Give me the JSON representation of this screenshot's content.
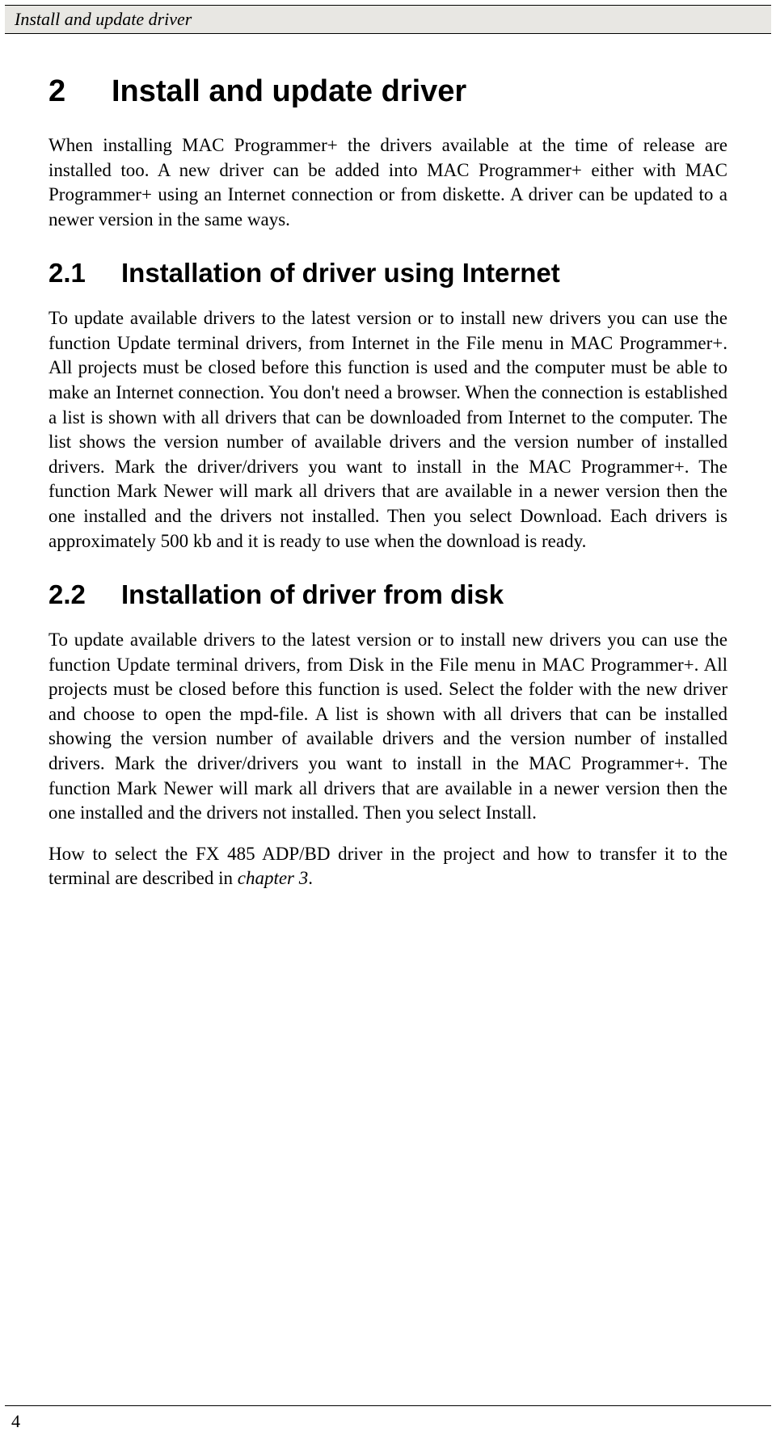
{
  "header": {
    "title": "Install and update driver"
  },
  "main": {
    "h1": {
      "num": "2",
      "title": "Install and update driver"
    },
    "intro": "When installing MAC Programmer+ the drivers available at the time of release are installed too. A new driver can be added into MAC Programmer+ either with MAC Programmer+ using an Internet connection or from diskette. A driver can be updated to a newer version in the same ways.",
    "s1": {
      "num": "2.1",
      "title": "Installation of driver using Internet",
      "body": "To update available drivers to the latest version or to install new drivers you can use the function Update terminal drivers, from Internet in the File menu in MAC Programmer+. All projects must be closed before this function is used and the computer must be able to make an Internet connection. You don't need a browser. When the connection is established a list is shown with all drivers that can be downloaded from Internet to the computer. The list shows the version number of available drivers and the version number of installed drivers. Mark the driver/drivers you want to install in the MAC Programmer+. The function Mark Newer will mark all drivers that are available in a newer version then the one installed and the drivers not installed. Then you select Download. Each drivers is approximately 500 kb and it is ready to use when the download is ready."
    },
    "s2": {
      "num": "2.2",
      "title": "Installation of driver from disk",
      "body": "To update available drivers to the latest version or to install new drivers you can use the function Update terminal drivers, from Disk in the File menu in MAC Programmer+. All projects must be closed before this function is used. Select the folder with the new driver and choose to open the mpd-file. A list is shown with all drivers that can be installed showing the version number of available drivers and the version number of installed drivers. Mark the driver/drivers you want to install in the MAC Programmer+. The function Mark Newer will mark all drivers that are available in a newer version then the one installed and the drivers not installed. Then you select Install.",
      "note_pre": "How to select the FX 485 ADP/BD driver in the project and how to transfer it to the terminal are described in ",
      "note_italic": "chapter 3",
      "note_post": "."
    }
  },
  "footer": {
    "page": "4"
  }
}
